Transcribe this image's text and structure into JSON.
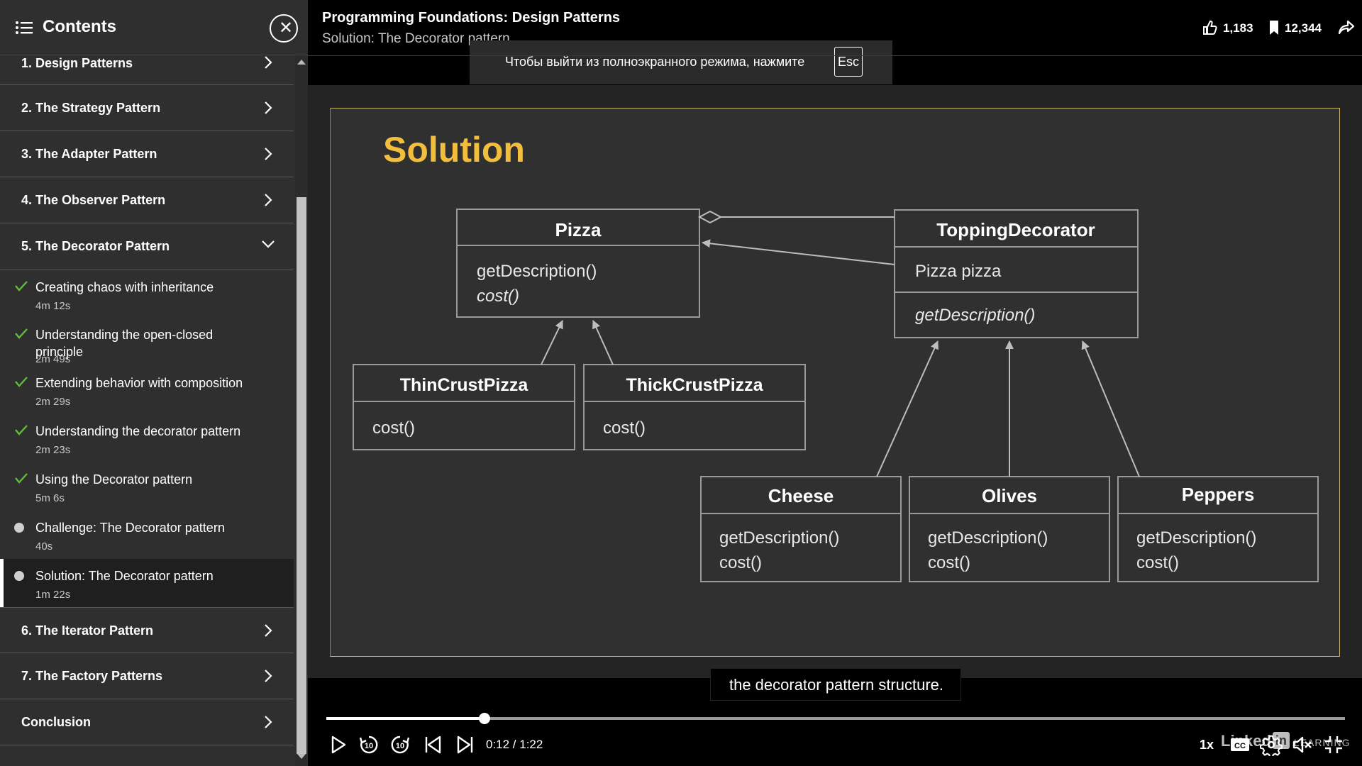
{
  "sidebar": {
    "title": "Contents",
    "chapters": [
      {
        "label": "1. Design Patterns"
      },
      {
        "label": "2. The Strategy Pattern"
      },
      {
        "label": "3. The Adapter Pattern"
      },
      {
        "label": "4. The Observer Pattern"
      },
      {
        "label": "5. The Decorator Pattern"
      },
      {
        "label": "6. The Iterator Pattern"
      },
      {
        "label": "7. The Factory Patterns"
      },
      {
        "label": "Conclusion"
      }
    ],
    "lessons": [
      {
        "title": "Creating chaos with inheritance",
        "duration": "4m 12s",
        "status": "completed"
      },
      {
        "title": "Understanding the open-closed principle",
        "duration": "2m 49s",
        "status": "completed"
      },
      {
        "title": "Extending behavior with composition",
        "duration": "2m 29s",
        "status": "completed"
      },
      {
        "title": "Understanding the decorator pattern",
        "duration": "2m 23s",
        "status": "completed"
      },
      {
        "title": "Using the Decorator pattern",
        "duration": "5m 6s",
        "status": "completed"
      },
      {
        "title": "Challenge: The Decorator pattern",
        "duration": "40s",
        "status": "not-started"
      },
      {
        "title": "Solution: The Decorator pattern",
        "duration": "1m 22s",
        "status": "current"
      }
    ]
  },
  "header": {
    "course_title": "Programming Foundations: Design Patterns",
    "video_title": "Solution: The Decorator pattern",
    "likes": "1,183",
    "saves": "12,344"
  },
  "fullscreen_notice": {
    "text": "Чтобы выйти из полноэкранного режима, нажмите",
    "key": "Esc"
  },
  "slide": {
    "title": "Solution",
    "classes": {
      "pizza": {
        "name": "Pizza",
        "m1": "getDescription()",
        "m2": "cost()"
      },
      "thin": {
        "name": "ThinCrustPizza",
        "m1": "cost()"
      },
      "thick": {
        "name": "ThickCrustPizza",
        "m1": "cost()"
      },
      "topping": {
        "name": "ToppingDecorator",
        "field": "Pizza pizza",
        "m1": "getDescription()"
      },
      "cheese": {
        "name": "Cheese",
        "m1": "getDescription()",
        "m2": "cost()"
      },
      "olives": {
        "name": "Olives",
        "m1": "getDescription()",
        "m2": "cost()"
      },
      "peppers": {
        "name": "Peppers",
        "m1": "getDescription()",
        "m2": "cost()"
      }
    }
  },
  "caption": "the decorator pattern structure.",
  "brand": {
    "linked": "Linked",
    "in": "in",
    "learning": "LEARNING"
  },
  "player": {
    "time": "0:12 / 1:22",
    "progress": 0.1553,
    "speed": "1x",
    "cc_label": "CC"
  },
  "colors": {
    "sidebar_bg": "#2f2f2f",
    "check_green": "#5fbf3a",
    "slide_title": "#f2be3c",
    "slide_bg": "#303030"
  }
}
